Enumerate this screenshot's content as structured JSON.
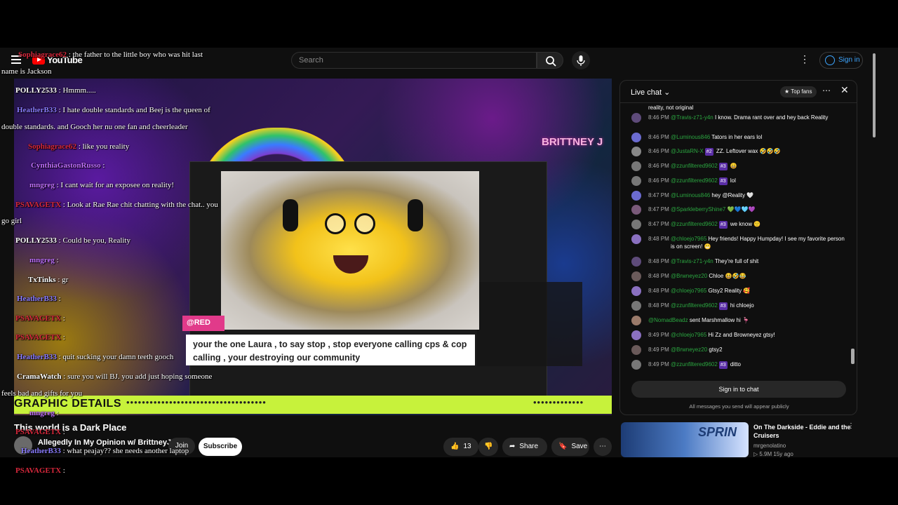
{
  "header": {
    "logo_text": "YouTube",
    "search_placeholder": "Search",
    "signin_label": "Sign in"
  },
  "video": {
    "brand_text": "BRITTNEY J",
    "pink_label": "@RED",
    "caption": "your the one Laura , to say stop , stop everyone calling cps & cop calling , your destroying our community",
    "banner_text": "GRAPHIC DETAILS",
    "banner_dots": "••••••••••••••••••••••••••••••••••••",
    "banner_dots_right": "•••••••••••••"
  },
  "overlay_chat": [
    {
      "name": "Sophiagrace62",
      "text": ": the father to the little boy who was hit last",
      "name_color": "#d8283c"
    },
    {
      "name": "",
      "text": "name is Jackson",
      "name_color": "#ffffff"
    },
    {
      "name": "POLLY2533",
      "text": ": Hmmm.....",
      "name_color": "#ffffff"
    },
    {
      "name": "HeatherB33",
      "text": ": I hate double standards and Beej is the queen of",
      "name_color": "#8a7cff"
    },
    {
      "name": "",
      "text": "double standards. and Gooch her nu   one fan and cheerleader",
      "name_color": "#ffffff"
    },
    {
      "name": "Sophiagrace62",
      "text": ": like you reality",
      "name_color": "#d8283c"
    },
    {
      "name": "CynthiaGastonRusso",
      "text": ":",
      "name_color": "#c070ff"
    },
    {
      "name": "mngreg",
      "text": ": I cant wait for an exposee on reality!",
      "name_color": "#c070ff"
    },
    {
      "name": "PSAVAGETX",
      "text": ": Look at Rae Rae chit chatting with the chat.. you",
      "name_color": "#d8283c"
    },
    {
      "name": "",
      "text": "go girl",
      "name_color": "#ffffff"
    },
    {
      "name": "POLLY2533",
      "text": ": Could be you, Reality",
      "name_color": "#ffffff"
    },
    {
      "name": "mngreg",
      "text": ":",
      "name_color": "#c070ff"
    },
    {
      "name": "TxTinks",
      "text": ": gr",
      "name_color": "#ffffff"
    },
    {
      "name": "HeatherB33",
      "text": ":",
      "name_color": "#8a7cff"
    },
    {
      "name": "PSAVAGETX",
      "text": ":",
      "name_color": "#d8283c"
    },
    {
      "name": "PSAVAGETX",
      "text": ":",
      "name_color": "#d8283c"
    },
    {
      "name": "HeatherB33",
      "text": ": quit sucking your damn teeth gooch",
      "name_color": "#8a7cff"
    },
    {
      "name": "CramaWatch",
      "text": ": sure you will BJ. you add just hoping someone",
      "name_color": "#ffffff"
    },
    {
      "name": "",
      "text": "feels bad and gifts for you",
      "name_color": "#ffffff"
    },
    {
      "name": "mngreg",
      "text": ":",
      "name_color": "#c070ff"
    },
    {
      "name": "PSAVAGETX",
      "text": ":",
      "name_color": "#d8283c"
    },
    {
      "name": "HeatherB33",
      "text": ": what peajay?? she needs another laptop",
      "name_color": "#8a7cff"
    },
    {
      "name": "PSAVAGETX",
      "text": ":",
      "name_color": "#d8283c"
    }
  ],
  "below_video": {
    "title": "This world is a Dark Place",
    "channel": "Allegedly In My Opinion w/ BrittneyJ",
    "join": "Join",
    "subscribe": "Subscribe",
    "likes": "13",
    "share": "Share",
    "save": "Save"
  },
  "live_chat": {
    "title": "Live chat",
    "top_fans": "Top fans",
    "messages": [
      {
        "time": "",
        "author": "",
        "text": "reality, not original"
      },
      {
        "time": "8:46 PM",
        "author": "@Travis-z71-y4n",
        "text": "I know. Drama rant over and hey back Reality"
      },
      {
        "time": "8:46 PM",
        "author": "@Luminous846",
        "text": "Tators in her ears lol"
      },
      {
        "time": "8:46 PM",
        "author": "@JustaRN-X",
        "badge": "#2",
        "text": "ZZ. Leftover wax 🤣🤣🤣"
      },
      {
        "time": "8:46 PM",
        "author": "@zzunfiltered9602",
        "badge": "#3",
        "text": "😄"
      },
      {
        "time": "8:46 PM",
        "author": "@zzunfiltered9602",
        "badge": "#3",
        "text": "lol"
      },
      {
        "time": "8:47 PM",
        "author": "@Luminous846",
        "text": "hey @Reality 🤍"
      },
      {
        "time": "8:47 PM",
        "author": "@SparkleberryShine7",
        "text": "💚💙🩵💜"
      },
      {
        "time": "8:47 PM",
        "author": "@zzunfiltered9602",
        "badge": "#3",
        "text": "we know 🙂"
      },
      {
        "time": "8:48 PM",
        "author": "@chloejo7965",
        "text": "Hey friends! Happy Humpday! I see my favorite person is on screen! 😬"
      },
      {
        "time": "8:48 PM",
        "author": "@Travis-z71-y4n",
        "text": "They're full of shit"
      },
      {
        "time": "8:48 PM",
        "author": "@Brwneyez20",
        "text": "Chloe 😆🤣😂"
      },
      {
        "time": "8:48 PM",
        "author": "@chloejo7965",
        "text": "Gtsy2 Reality 🥰"
      },
      {
        "time": "8:48 PM",
        "author": "@zzunfiltered9602",
        "badge": "#3",
        "text": "hi chloejo"
      },
      {
        "time": "",
        "author": "@NomadBeadz",
        "text": "sent Marshmallow hi 🦩"
      },
      {
        "time": "8:49 PM",
        "author": "@chloejo7965",
        "text": "Hi Zz and Browneyez gtsy!"
      },
      {
        "time": "8:49 PM",
        "author": "@Brwneyez20",
        "text": "gtsy2"
      },
      {
        "time": "8:49 PM",
        "author": "@zzunfiltered9602",
        "badge": "#3",
        "text": "ditto"
      }
    ],
    "signin_button": "Sign in to chat",
    "note": "All messages you send will appear publicly"
  },
  "recommended": {
    "thumb_text": "SPRIN",
    "title": "On The Darkside - Eddie and the Cruisers",
    "channel": "mrgenolatino",
    "meta": "▷ 5.9M  15y ago"
  }
}
